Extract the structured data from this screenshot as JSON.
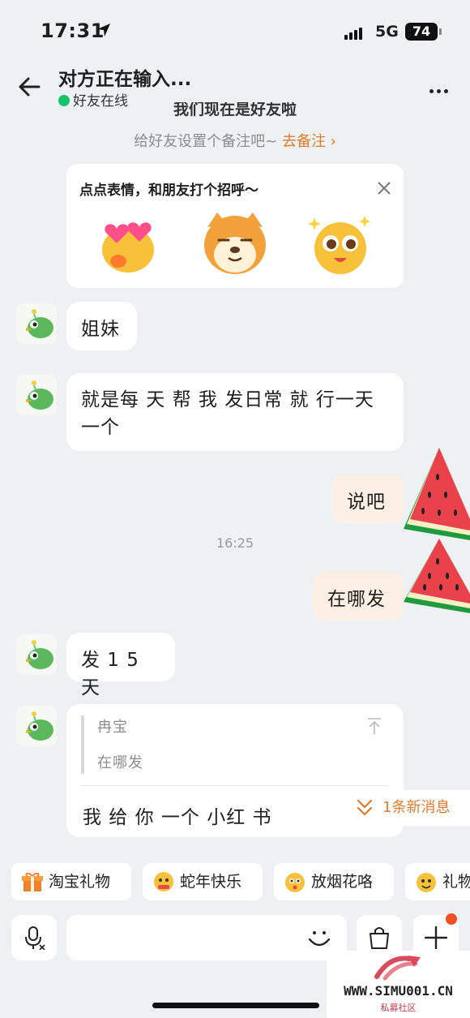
{
  "status_bar": {
    "time": "17:31",
    "network": "5G",
    "battery": "74"
  },
  "header": {
    "title": "对方正在输入...",
    "status": "好友在线"
  },
  "notice": {
    "friends_text": "我们现在是好友啦",
    "remark_prompt": "给好友设置个备注吧~",
    "remark_link": "去备注 ›"
  },
  "sticker_card": {
    "title": "点点表情，和朋友打个招呼～"
  },
  "messages": [
    {
      "from": "friend",
      "text": "姐妹"
    },
    {
      "from": "friend",
      "text": "就是每 天 帮 我 发日常 就 行一天",
      "text2": "一个"
    },
    {
      "from": "me",
      "text": "说吧"
    },
    {
      "from": "me",
      "text": "在哪发"
    },
    {
      "from": "friend",
      "text": "发 1 5 天"
    },
    {
      "from": "friend",
      "quote_name": "冉宝",
      "quote_text": "在哪发",
      "text": "我 给 你 一个  小红 书"
    }
  ],
  "timestamp": "16:25",
  "new_message_pill": "1条新消息",
  "quick_chips": [
    {
      "label": "淘宝礼物",
      "icon": "gift-icon"
    },
    {
      "label": "蛇年快乐",
      "icon": "emoji-face-icon"
    },
    {
      "label": "放烟花咯",
      "icon": "emoji-face-icon"
    },
    {
      "label": "礼物",
      "icon": "emoji-face-icon"
    }
  ],
  "watermark": {
    "site": "WWW.SIMU001.CN",
    "sub": "私募社区"
  },
  "colors": {
    "accent": "#e07a2c",
    "online": "#19c36a",
    "my_bubble": "#fbf0e3",
    "background": "#eef1f4"
  }
}
